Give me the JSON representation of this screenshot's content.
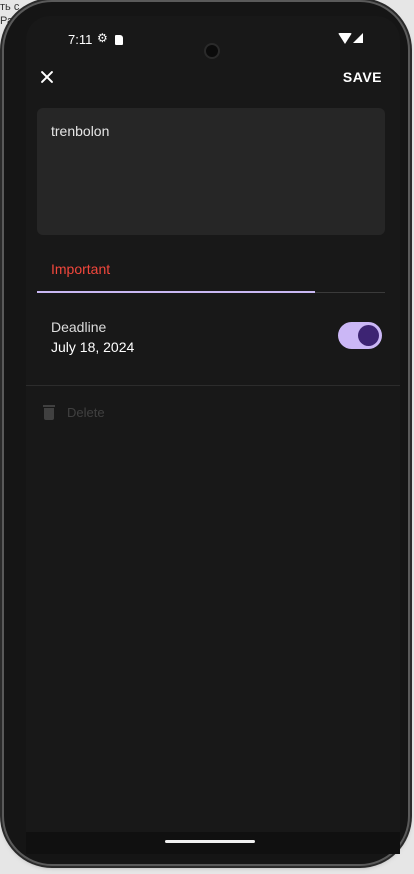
{
  "background_text": [
    "ть с",
    "Ра"
  ],
  "status_bar": {
    "time": "7:11",
    "icons": [
      "gear-icon",
      "sd-card-icon",
      "wifi-icon",
      "signal-icon"
    ]
  },
  "toolbar": {
    "close_icon": "close-icon",
    "save_label": "SAVE"
  },
  "form": {
    "text_value": "trenbolon",
    "importance_value": "Important",
    "deadline_label": "Deadline",
    "deadline_date": "July 18, 2024",
    "deadline_enabled": true,
    "delete_label": "Delete",
    "delete_icon": "trash-icon"
  },
  "colors": {
    "accent": "#c9b8f3",
    "switch_thumb": "#3d2473",
    "importance": "#f2473c",
    "disabled": "#404040"
  }
}
